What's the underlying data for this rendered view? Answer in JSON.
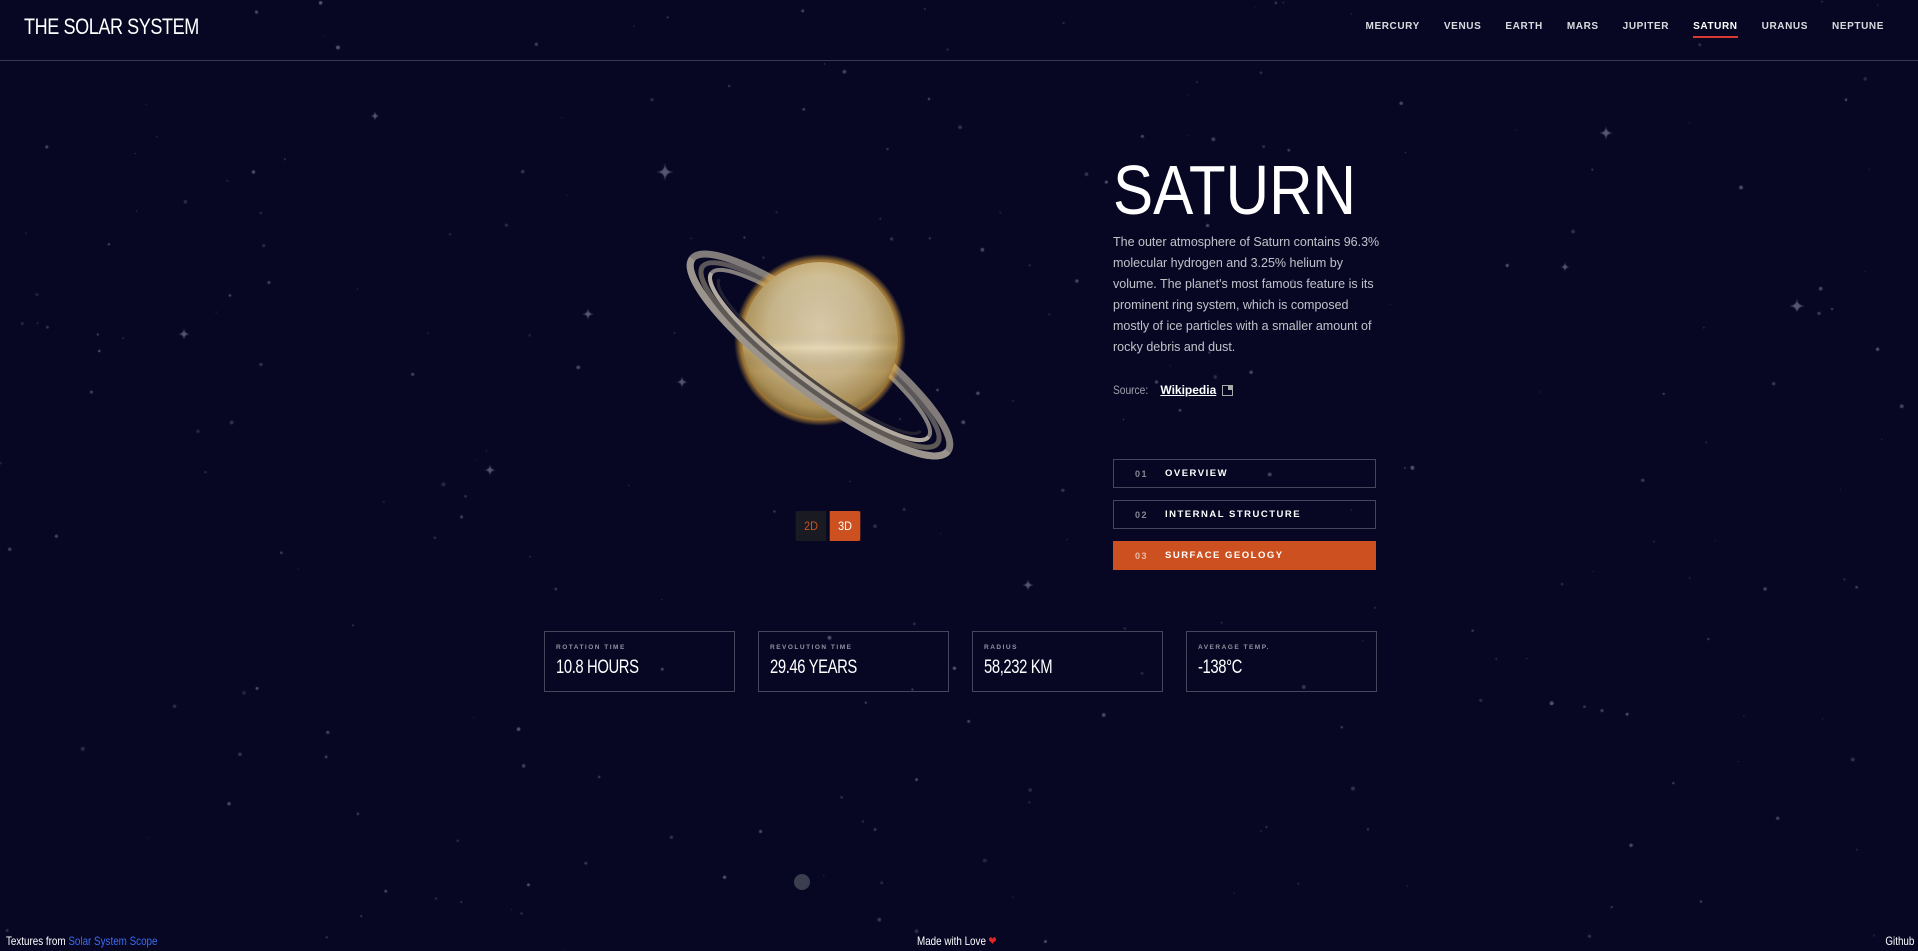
{
  "header": {
    "logo": "THE SOLAR SYSTEM",
    "nav": [
      {
        "label": "MERCURY",
        "active": false
      },
      {
        "label": "VENUS",
        "active": false
      },
      {
        "label": "EARTH",
        "active": false
      },
      {
        "label": "MARS",
        "active": false
      },
      {
        "label": "JUPITER",
        "active": false
      },
      {
        "label": "SATURN",
        "active": true
      },
      {
        "label": "URANUS",
        "active": false
      },
      {
        "label": "NEPTUNE",
        "active": false
      }
    ]
  },
  "toggle": {
    "option_2d": "2D",
    "option_3d": "3D",
    "selected": "3D"
  },
  "planet": {
    "name": "SATURN",
    "description": "The outer atmosphere of Saturn contains 96.3% molecular hydrogen and 3.25% helium by volume. The planet's most famous feature is its prominent ring system, which is composed mostly of ice particles with a smaller amount of rocky debris and dust.",
    "source_label": "Source:",
    "source_link": "Wikipedia"
  },
  "tabs": [
    {
      "num": "01",
      "label": "OVERVIEW",
      "active": false
    },
    {
      "num": "02",
      "label": "INTERNAL STRUCTURE",
      "active": false
    },
    {
      "num": "03",
      "label": "SURFACE GEOLOGY",
      "active": true
    }
  ],
  "stats": [
    {
      "label": "ROTATION TIME",
      "value": "10.8 HOURS"
    },
    {
      "label": "REVOLUTION TIME",
      "value": "29.46 YEARS"
    },
    {
      "label": "RADIUS",
      "value": "58,232 KM"
    },
    {
      "label": "AVERAGE TEMP.",
      "value": "-138°C"
    }
  ],
  "footer": {
    "textures_prefix": "Textures from",
    "textures_link": "Solar System Scope",
    "made_with": "Made with Love",
    "github": "Github"
  },
  "colors": {
    "background": "#070724",
    "accent": "#CD5120",
    "nav_underline": "#D83A34",
    "link_blue": "#3a6df0"
  }
}
